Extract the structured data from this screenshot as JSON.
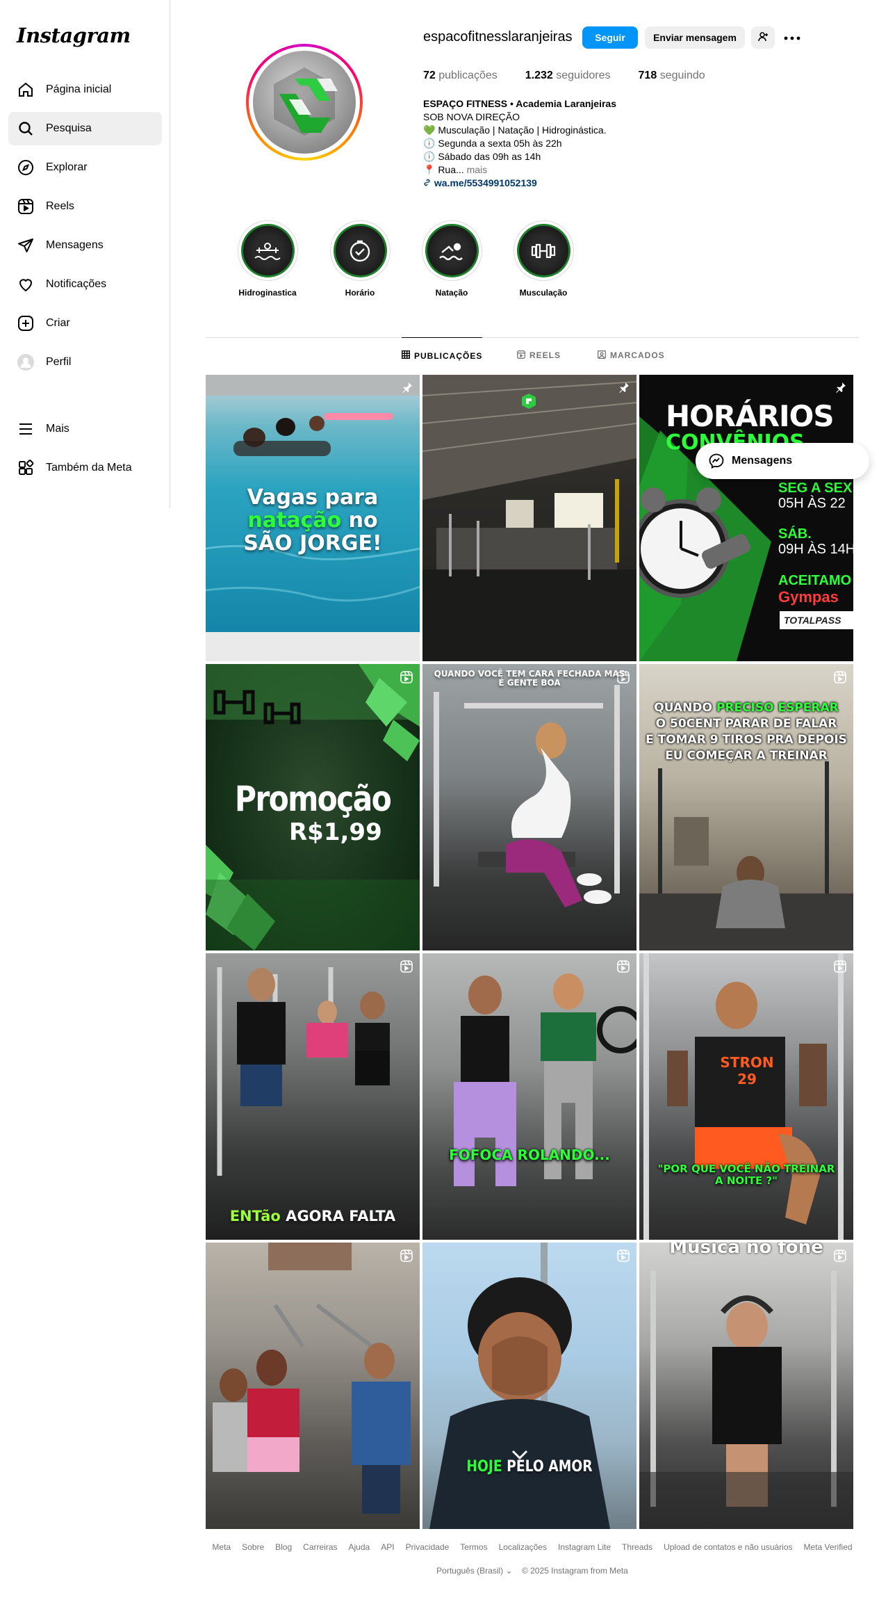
{
  "sidebar": {
    "logo": "Instagram",
    "items": [
      {
        "label": "Página inicial",
        "icon": "home-icon"
      },
      {
        "label": "Pesquisa",
        "icon": "search-icon"
      },
      {
        "label": "Explorar",
        "icon": "compass-icon"
      },
      {
        "label": "Reels",
        "icon": "reels-icon"
      },
      {
        "label": "Mensagens",
        "icon": "send-icon"
      },
      {
        "label": "Notificações",
        "icon": "heart-icon"
      },
      {
        "label": "Criar",
        "icon": "plus-square-icon"
      },
      {
        "label": "Perfil",
        "icon": "avatar-icon"
      },
      {
        "label": "Mais",
        "icon": "menu-icon"
      },
      {
        "label": "Também da Meta",
        "icon": "meta-apps-icon"
      }
    ],
    "active_index": 1
  },
  "profile": {
    "username": "espacofitnesslaranjeiras",
    "follow_label": "Seguir",
    "message_label": "Enviar mensagem",
    "stats": {
      "posts_count": "72",
      "posts_label": "publicações",
      "followers_count": "1.232",
      "followers_label": "seguidores",
      "following_count": "718",
      "following_label": "seguindo"
    },
    "bio": {
      "name": "ESPAÇO FITNESS • Academia Laranjeiras",
      "line1": "SOB NOVA DIREÇÃO",
      "line2": "💚 Musculação | Natação | Hidroginástica.",
      "line3": "🕕 Segunda a sexta 05h às 22h",
      "line4": "🕕 Sábado das 09h as 14h",
      "line5": "📍 Rua...",
      "more": "mais",
      "link": "wa.me/5534991052139"
    }
  },
  "highlights": [
    {
      "label": "Hidroginastica"
    },
    {
      "label": "Horário"
    },
    {
      "label": "Natação"
    },
    {
      "label": "Musculação"
    }
  ],
  "tabs": [
    {
      "label": "PUBLICAÇÕES",
      "active": true
    },
    {
      "label": "REELS",
      "active": false
    },
    {
      "label": "MARCADOS",
      "active": false
    }
  ],
  "posts": {
    "p1": {
      "line1": "Vagas para",
      "line2a": "natação",
      "line2b": " no",
      "line3": "SÃO JORGE!"
    },
    "p3": {
      "title": "HORÁRIOS",
      "sub": "CONVÊNIOS",
      "l1": "SEG A SEX",
      "l2": "05H ÀS 22",
      "l3": "SÁB.",
      "l4": "09H ÀS 14H",
      "l5": "ACEITAMO",
      "l6": "Gympas",
      "l7": "TOTALPASS"
    },
    "p4": {
      "title": "Promoção",
      "price": "R$1,99"
    },
    "p5": {
      "caption": "QUANDO VOCÊ TEM CARA FECHADA MAS É GENTE BOA"
    },
    "p6": {
      "l1a": "QUANDO ",
      "l1b": "PRECISO ESPERAR",
      "l2": "O 50CENT PARAR DE FALAR",
      "l3": "E TOMAR 9 TIROS PRA DEPOIS",
      "l4": "EU COMEÇAR A TREINAR"
    },
    "p7": {
      "a": "ENT",
      "b": "ão",
      "c": " AGORA FALTA"
    },
    "p8": {
      "caption": "FOFOCA ROLANDO..."
    },
    "p9": {
      "caption": "\"POR QUE VOCÊ NÃO TREINAR A NOITE ?\"",
      "jersey": "STRON 29"
    },
    "p11": {
      "a": "HOJE",
      "b": " PELO AMOR"
    },
    "p12": {
      "caption": "Música no fone"
    }
  },
  "floating_messages": {
    "label": "Mensagens"
  },
  "footer": {
    "links": [
      "Meta",
      "Sobre",
      "Blog",
      "Carreiras",
      "Ajuda",
      "API",
      "Privacidade",
      "Termos",
      "Localizações",
      "Instagram Lite",
      "Threads",
      "Upload de contatos e não usuários",
      "Meta Verified"
    ],
    "language": "Português (Brasil)",
    "copyright": "© 2025 Instagram from Meta"
  },
  "colors": {
    "primary": "#0095f6",
    "neon_green": "#2cff3a",
    "link": "#00376b"
  }
}
